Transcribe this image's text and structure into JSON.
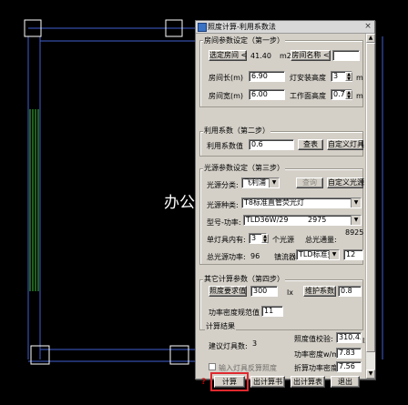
{
  "cad": {
    "room_label": "办公"
  },
  "dialog": {
    "title": "照度计算-利用系数法",
    "close_label": "×",
    "room": {
      "group_title": "房间参数设定（第一步）",
      "select_room_btn": "选定房间 <",
      "area_value": "41.40",
      "area_unit": "m2",
      "room_name_btn": "房间名称 <",
      "room_name_value": "",
      "length_label": "房间长(m)",
      "length_value": "6.90",
      "lamp_height_label": "灯安装高度",
      "lamp_height_value": "3",
      "lamp_height_unit": "m",
      "width_label": "房间宽(m)",
      "width_value": "6.00",
      "work_height_label": "工作面高度",
      "work_height_value": "0.75",
      "work_height_unit": "m"
    },
    "coef": {
      "group_title": "利用系数（第二步）",
      "label": "利用系数值",
      "value": "0.6",
      "lookup_btn": "查表",
      "custom_btn": "自定义灯具"
    },
    "light": {
      "group_title": "光源参数设定（第三步）",
      "type_label": "光源分类:",
      "type_value": "飞利浦",
      "query_btn": "查询",
      "custom_btn": "自定义光源",
      "kind_label": "光源种类:",
      "kind_value": "T8标准直管荧光灯",
      "model_label": "型号-功率:",
      "model_value": "TLD36W/29",
      "model_value2": "2975",
      "count_label": "单灯具内有:",
      "count_value": "3",
      "count_unit": "个光源",
      "flux_label": "总光通量:",
      "flux_value": "8925",
      "power_label": "总光源功率:",
      "power_value": "96",
      "ballast_label": "镇流器",
      "ballast_value": "TLD标准型",
      "ballast_extra": "12"
    },
    "other": {
      "group_title": "其它计算参数（第四步）",
      "illum_btn": "照度要求值",
      "illum_value": "300",
      "illum_unit": "lx",
      "maint_btn": "维护系数",
      "maint_value": "0.8",
      "density_label": "功率密度规范值",
      "density_value": "11"
    },
    "result": {
      "group_title": "计算结果",
      "lamps_label": "建议灯具数:",
      "lamps_value": "3",
      "check_label": "照度值校验:",
      "check_value": "310.43",
      "check_unit": "lx",
      "density_label": "功率密度w/m2:",
      "density_value": "7.83",
      "convert_label": "折算功率密度:",
      "convert_value": "7.56",
      "auto_check_label": "输入灯具反算照度"
    },
    "buttons": {
      "help": "?",
      "calc": "计算",
      "calc_book": "出计算书",
      "calc_table": "出计算表",
      "exit": "退出"
    }
  }
}
